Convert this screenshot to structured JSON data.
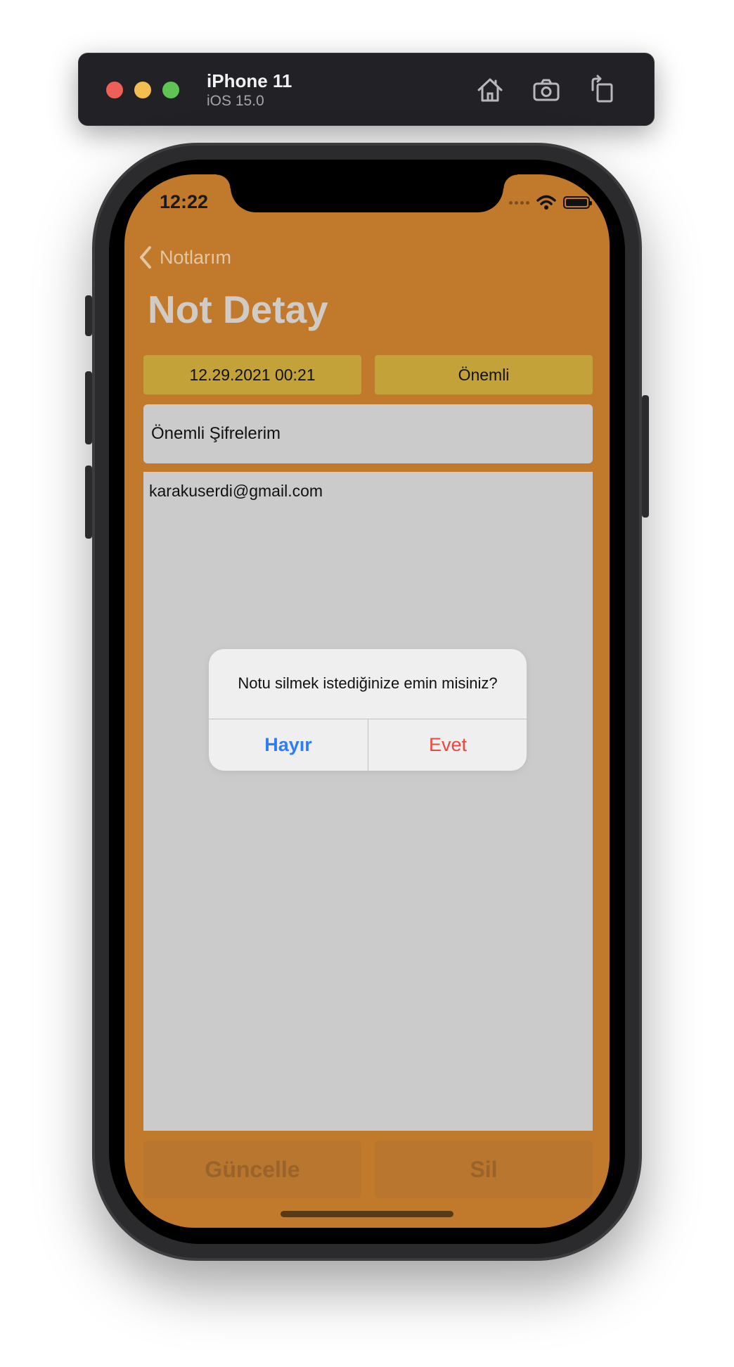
{
  "simulator": {
    "device_name": "iPhone 11",
    "os_version": "iOS 15.0",
    "toolbar_icons": [
      "home-icon",
      "screenshot-icon",
      "rotate-icon"
    ]
  },
  "status_bar": {
    "time": "12:22"
  },
  "nav": {
    "back_label": "Notlarım",
    "title": "Not Detay"
  },
  "note": {
    "date": "12.29.2021 00:21",
    "priority": "Önemli",
    "title": "Önemli Şifrelerim",
    "body": "karakuserdi@gmail.com"
  },
  "actions": {
    "update_label": "Güncelle",
    "delete_label": "Sil"
  },
  "alert": {
    "message": "Notu silmek istediğinize emin misiniz?",
    "cancel_label": "Hayır",
    "confirm_label": "Evet"
  },
  "colors": {
    "screen_background": "#c1792b",
    "chip_background": "#c3a23a",
    "field_background": "#cbcbcb",
    "alert_cancel": "#2e7cf6",
    "alert_confirm": "#e9473f"
  }
}
